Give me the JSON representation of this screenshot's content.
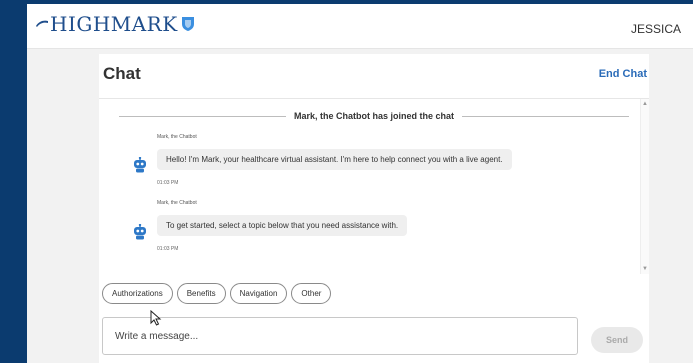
{
  "brand": {
    "logo_text": "HIGHMARK",
    "logo_color": "#1f4e8c"
  },
  "header": {
    "user_name": "JESSICA"
  },
  "chat": {
    "title": "Chat",
    "end_chat_label": "End Chat",
    "joined_notice": "Mark, the Chatbot has joined the chat",
    "messages": [
      {
        "sender": "Mark, the Chatbot",
        "text": "Hello! I'm Mark, your healthcare virtual assistant. I'm here to help connect you with a live agent.",
        "time": "01:03 PM"
      },
      {
        "sender": "Mark, the Chatbot",
        "text": "To get started, select a topic below that you need assistance with.",
        "time": "01:03 PM"
      }
    ],
    "quick_replies": [
      "Authorizations",
      "Benefits",
      "Navigation",
      "Other"
    ],
    "input_placeholder": "Write a message...",
    "send_label": "Send"
  },
  "icons": {
    "avatar": "robot-avatar-icon",
    "logo_mark": "shield-icon",
    "cursor": "mouse-cursor-icon"
  },
  "colors": {
    "accent": "#2a6bb8",
    "frame_border": "#0b3b6f",
    "bot_avatar": "#2d78c7"
  }
}
